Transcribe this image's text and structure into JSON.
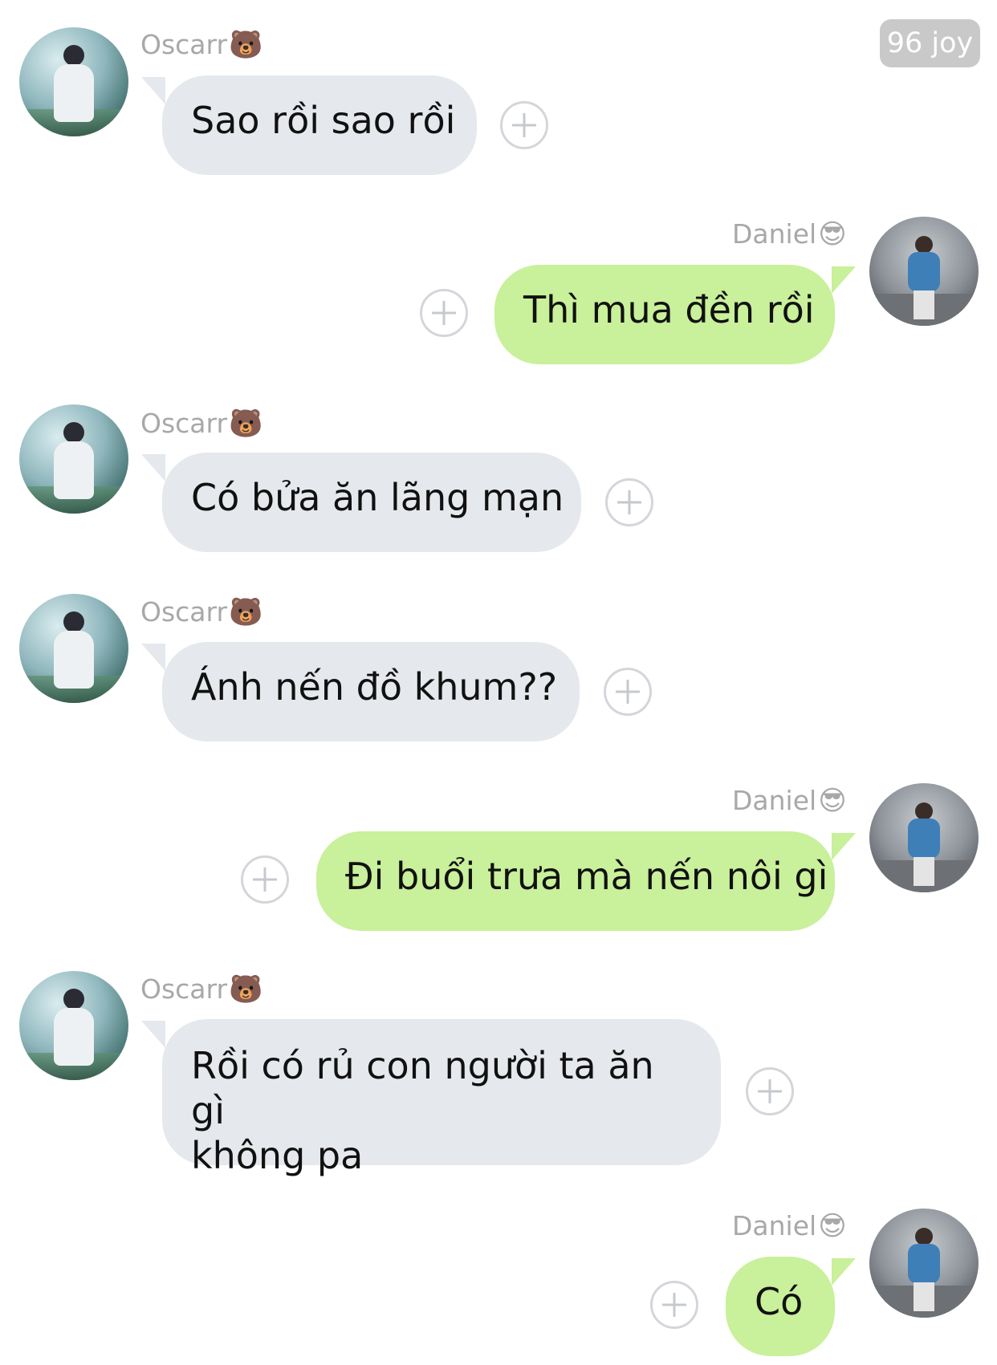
{
  "header": {
    "badge": "96 joy"
  },
  "contacts": {
    "other": {
      "name": "Oscarr",
      "emoji": "🐻",
      "avatar": "avatar-photo"
    },
    "me": {
      "name": "Daniel",
      "emoji": "😎",
      "avatar": "avatar-photo"
    }
  },
  "messages": [
    {
      "sender": "Oscarr",
      "emoji": "🐻",
      "text": "Sao rồi sao rồi"
    },
    {
      "sender": "Daniel",
      "emoji": "😎",
      "text": "Thì mua đền rồi"
    },
    {
      "sender": "Oscarr",
      "emoji": "🐻",
      "text": "Có bửa ăn lãng mạn"
    },
    {
      "sender": "Oscarr",
      "emoji": "🐻",
      "text": "Ánh nến đồ khum??"
    },
    {
      "sender": "Daniel",
      "emoji": "😎",
      "text": "Đi buổi trưa mà nến nôi gì"
    },
    {
      "sender": "Oscarr",
      "emoji": "🐻",
      "text": "Rồi có rủ con người ta ăn gì"
    },
    {
      "sender": "Oscarr",
      "emoji": "🐻",
      "text": "không pa"
    },
    {
      "sender": "Daniel",
      "emoji": "😎",
      "text": "Có"
    }
  ],
  "icons": {
    "react_button": "add-reaction-icon"
  },
  "colors": {
    "incoming_bubble": "#e5e8ec",
    "outgoing_bubble": "#c9f09a",
    "name_text": "#a8a8a8"
  }
}
